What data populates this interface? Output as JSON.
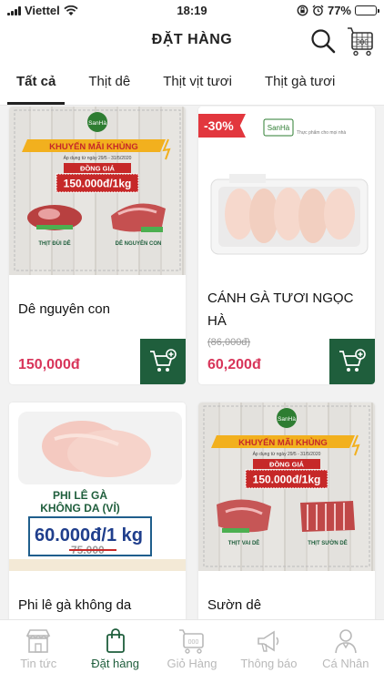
{
  "status_bar": {
    "carrier": "Viettel",
    "time": "18:19",
    "battery": "77%",
    "battery_level": 0.77
  },
  "header": {
    "title": "ĐẶT HÀNG"
  },
  "tabs": [
    {
      "label": "Tất cả"
    },
    {
      "label": "Thịt dê"
    },
    {
      "label": "Thịt vịt tươi"
    },
    {
      "label": "Thịt gà tươi"
    }
  ],
  "products": [
    {
      "name": "Dê nguyên con",
      "price": "150,000đ",
      "banner": {
        "brand": "SanHà",
        "promo": "KHUYẾN MÃI KHỦNG",
        "period": "Áp dụng từ ngày 29/5 - 31/5/2020",
        "price_title": "ĐỒNG GIÁ",
        "price": "150.000đ/1kg",
        "left_label": "THỊT ĐÙI DÊ",
        "right_label": "DÊ NGUYÊN CON"
      }
    },
    {
      "name": "CÁNH GÀ TƯƠI NGỌC HÀ",
      "price": "60,200đ",
      "old_price": "(86,000đ)",
      "discount": "-30%",
      "banner": {
        "brand": "SanHà",
        "tagline": "Thực phẩm cho mọi nhà"
      }
    },
    {
      "name": "Phi lê gà không da",
      "price": "",
      "banner": {
        "title_line1": "PHI LÊ GÀ",
        "title_line2": "KHÔNG DA (VỈ)",
        "price": "60.000đ/1 kg",
        "old_price": "75.000"
      }
    },
    {
      "name": "Sườn dê",
      "price": "",
      "banner": {
        "brand": "SanHà",
        "promo": "KHUYẾN MÃI KHỦNG",
        "period": "Áp dụng từ ngày 29/5 - 31/5/2020",
        "price_title": "ĐỒNG GIÁ",
        "price": "150.000đ/1kg",
        "left_label": "THỊT VAI DÊ",
        "right_label": "THỊT SƯỜN DÊ"
      }
    }
  ],
  "bottom_nav": [
    {
      "label": "Tin tức",
      "icon": "store-icon"
    },
    {
      "label": "Đặt hàng",
      "icon": "shopping-bag-icon"
    },
    {
      "label": "Giỏ Hàng",
      "icon": "cart-icon"
    },
    {
      "label": "Thông báo",
      "icon": "megaphone-icon"
    },
    {
      "label": "Cá Nhân",
      "icon": "person-icon"
    }
  ],
  "colors": {
    "accent_green": "#1f5e3c",
    "price_red": "#d8355a",
    "discount_red": "#e2373e"
  }
}
